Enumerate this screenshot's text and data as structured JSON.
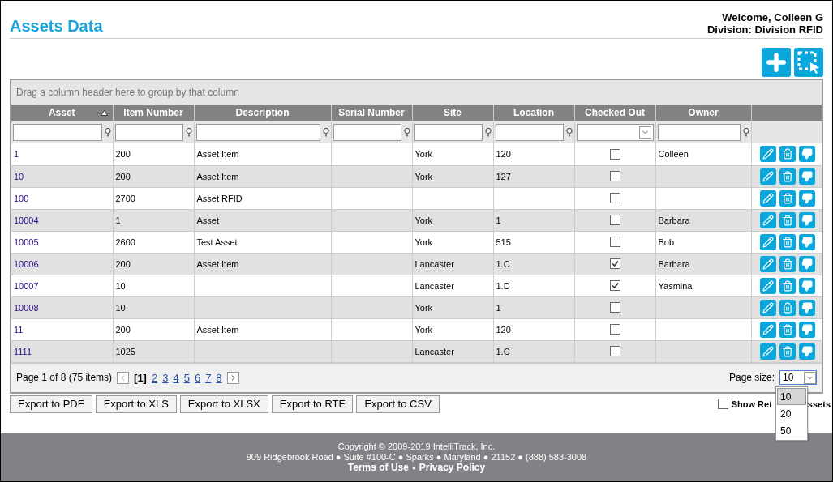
{
  "header": {
    "title": "Assets Data",
    "welcome": "Welcome, Colleen G",
    "division": "Division: Division RFID"
  },
  "grid": {
    "group_panel": "Drag a column header here to group by that column",
    "columns": [
      {
        "label": "Asset",
        "sorted": true,
        "kind": "text"
      },
      {
        "label": "Item Number",
        "sorted": false,
        "kind": "text"
      },
      {
        "label": "Description",
        "sorted": false,
        "kind": "text"
      },
      {
        "label": "Serial Number",
        "sorted": false,
        "kind": "text"
      },
      {
        "label": "Site",
        "sorted": false,
        "kind": "text"
      },
      {
        "label": "Location",
        "sorted": false,
        "kind": "text"
      },
      {
        "label": "Checked Out",
        "sorted": false,
        "kind": "select"
      },
      {
        "label": "Owner",
        "sorted": false,
        "kind": "text"
      }
    ],
    "rows": [
      {
        "asset": "1",
        "item_number": "200",
        "description": "Asset Item",
        "site": "York",
        "location": "120",
        "checked_out": false,
        "owner": "Colleen"
      },
      {
        "asset": "10",
        "item_number": "200",
        "description": "Asset Item",
        "site": "York",
        "location": "127",
        "checked_out": false
      },
      {
        "asset": "100",
        "item_number": "2700",
        "description": "Asset RFID",
        "checked_out": false
      },
      {
        "asset": "10004",
        "item_number": "1",
        "description": "Asset",
        "site": "York",
        "location": "1",
        "checked_out": false,
        "owner": "Barbara"
      },
      {
        "asset": "10005",
        "item_number": "2600",
        "description": "Test Asset",
        "site": "York",
        "location": "515",
        "checked_out": false,
        "owner": "Bob"
      },
      {
        "asset": "10006",
        "item_number": "200",
        "description": "Asset Item",
        "site": "Lancaster",
        "location": "1.C",
        "checked_out": true,
        "owner": "Barbara"
      },
      {
        "asset": "10007",
        "item_number": "10",
        "site": "Lancaster",
        "location": "1.D",
        "checked_out": true,
        "owner": "Yasmina"
      },
      {
        "asset": "10008",
        "item_number": "10",
        "site": "York",
        "location": "1",
        "checked_out": false
      },
      {
        "asset": "11",
        "item_number": "200",
        "description": "Asset Item",
        "site": "York",
        "location": "120",
        "checked_out": false
      },
      {
        "asset": "1111",
        "item_number": "1025",
        "site": "Lancaster",
        "location": "1.C",
        "checked_out": false
      }
    ],
    "pager": {
      "summary": "Page 1 of 8 (75 items)",
      "pages": [
        {
          "label": "[1]",
          "selected": true
        },
        {
          "label": "2",
          "selected": false
        },
        {
          "label": "3",
          "selected": false
        },
        {
          "label": "4",
          "selected": false
        },
        {
          "label": "5",
          "selected": false
        },
        {
          "label": "6",
          "selected": false
        },
        {
          "label": "7",
          "selected": false
        },
        {
          "label": "8",
          "selected": false
        }
      ],
      "page_size_label": "Page size:",
      "page_size": "10",
      "page_size_options": [
        {
          "label": "10",
          "selected": true
        },
        {
          "label": "20",
          "selected": false
        },
        {
          "label": "50",
          "selected": false
        }
      ]
    }
  },
  "exports": [
    "Export to PDF",
    "Export to XLS",
    "Export to XLSX",
    "Export to RTF",
    "Export to CSV"
  ],
  "show_retired": {
    "checked": false,
    "label_start": "Show Ret",
    "label_end": "ssets"
  },
  "footer": {
    "copyright": "Copyright © 2009-2019 IntelliTrack, Inc.",
    "address": "909 Ridgebrook Road ● Suite #100-C ● Sparks ● Maryland ● 21152 ● (888) 583-3008",
    "links": [
      "Terms of Use",
      "Privacy Policy"
    ],
    "separator": "●"
  }
}
